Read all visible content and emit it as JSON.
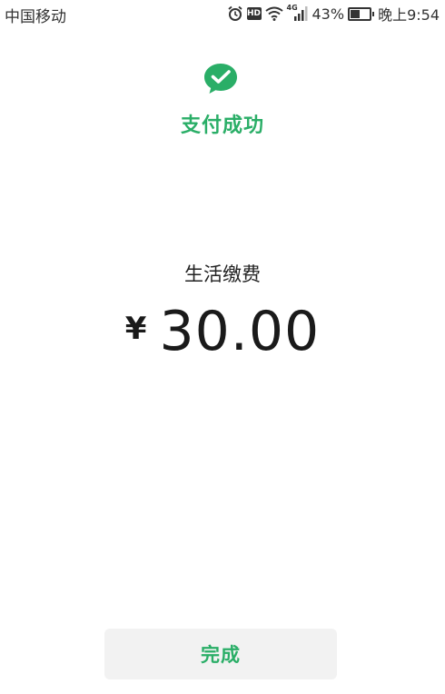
{
  "status_bar": {
    "carrier": "中国移动",
    "network": "4G",
    "hd": "HD",
    "battery_percent": "43%",
    "battery_level": 0.43,
    "time": "晚上9:54"
  },
  "result": {
    "title": "支付成功",
    "icon": "wechat-pay-check-icon",
    "accent_color": "#2aae67"
  },
  "payment": {
    "merchant": "生活缴费",
    "currency_symbol": "¥",
    "amount": "30.00"
  },
  "actions": {
    "done_label": "完成"
  }
}
